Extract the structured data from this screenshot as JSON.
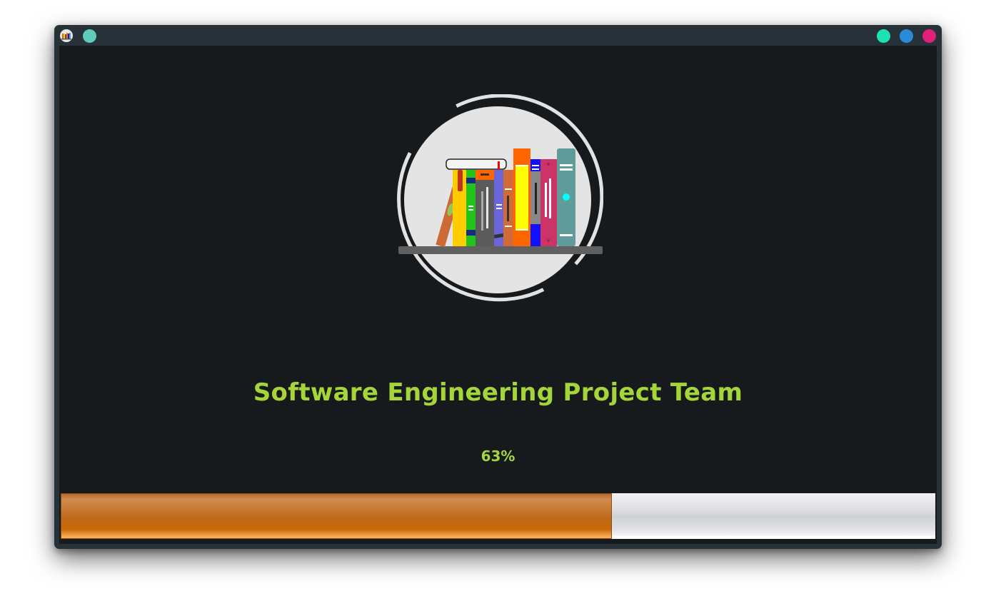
{
  "titlebar": {
    "icon": "bookshelf-app-icon",
    "left_dot_color": "#5ecbbd",
    "buttons": [
      {
        "name": "minimize-button",
        "color": "#1de1b0"
      },
      {
        "name": "maximize-button",
        "color": "#2a8ad8"
      },
      {
        "name": "close-button",
        "color": "#e0207a"
      }
    ]
  },
  "splash": {
    "logo": "bookshelf-logo-icon",
    "title": "Software Engineering Project Team",
    "progress_text": "63%",
    "progress_value": 0.63,
    "colors": {
      "text": "#a4d63a",
      "background": "#171a1d",
      "progress_fill": "#c86a08"
    }
  }
}
